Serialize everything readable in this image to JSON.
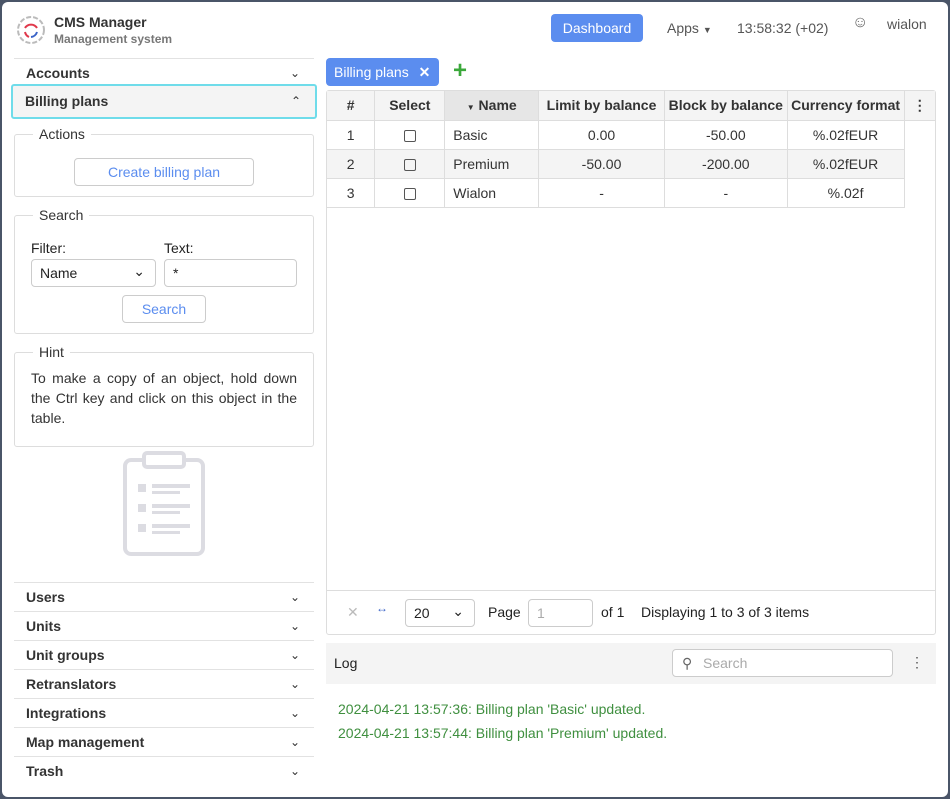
{
  "header": {
    "title": "CMS Manager",
    "subtitle": "Management system",
    "dashboard": "Dashboard",
    "apps": "Apps",
    "clock": "13:58:32 (+02)",
    "user": "wialon"
  },
  "sidebar": {
    "accounts": "Accounts",
    "billing_plans": "Billing plans",
    "actions": {
      "legend": "Actions",
      "create": "Create billing plan"
    },
    "search": {
      "legend": "Search",
      "filter_label": "Filter:",
      "filter_value": "Name",
      "text_label": "Text:",
      "text_value": "*",
      "button": "Search"
    },
    "hint": {
      "legend": "Hint",
      "text": "To make a copy of an object, hold down the Ctrl key and click on this object in the table."
    },
    "items": [
      "Users",
      "Units",
      "Unit groups",
      "Retranslators",
      "Integrations",
      "Map management",
      "Trash"
    ]
  },
  "main": {
    "tab": "Billing plans",
    "columns": [
      "#",
      "Select",
      "Name",
      "Limit by balance",
      "Block by balance",
      "Currency format"
    ],
    "rows": [
      [
        "1",
        "Basic",
        "0.00",
        "-50.00",
        "%.02fEUR"
      ],
      [
        "2",
        "Premium",
        "-50.00",
        "-200.00",
        "%.02fEUR"
      ],
      [
        "3",
        "Wialon",
        "-",
        "-",
        "%.02f"
      ]
    ],
    "pager": {
      "page_size": "20",
      "page_label": "Page",
      "page": "1",
      "of": "of 1",
      "display": "Displaying 1 to 3 of 3 items"
    }
  },
  "log": {
    "title": "Log",
    "search_placeholder": "Search",
    "lines": [
      "2024-04-21 13:57:36: Billing plan 'Basic' updated.",
      "2024-04-21 13:57:44: Billing plan 'Premium' updated."
    ]
  }
}
